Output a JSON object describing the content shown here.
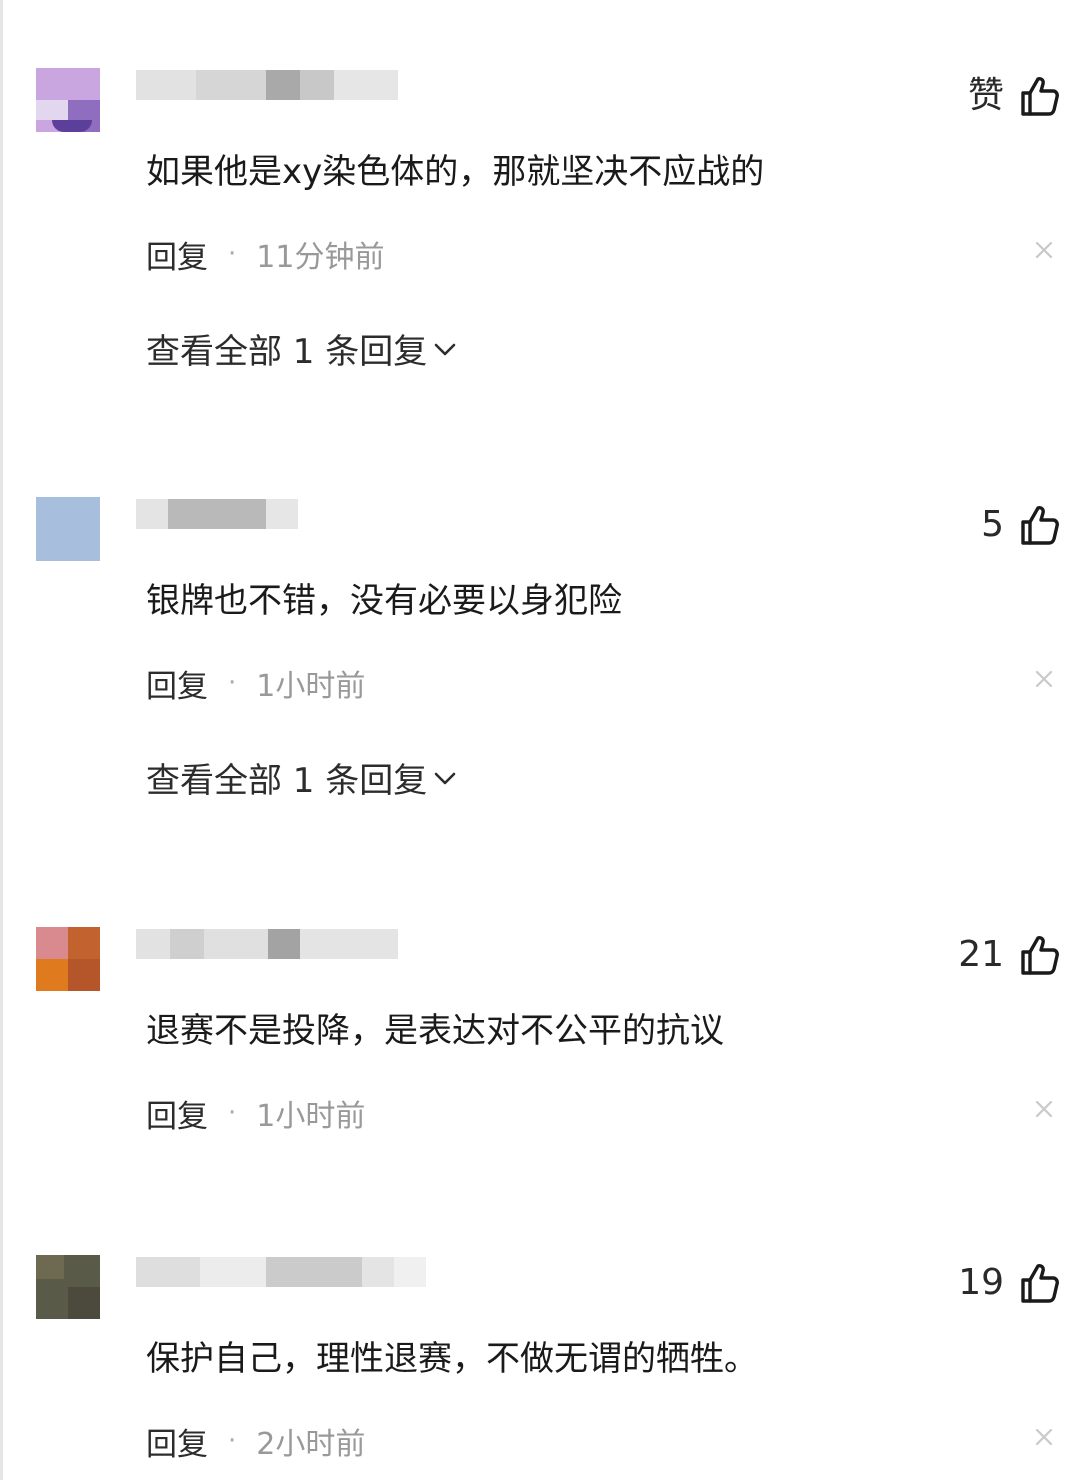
{
  "comments": [
    {
      "like_label": "赞",
      "text": "如果他是xy染色体的，那就坚决不应战的",
      "reply_label": "回复",
      "separator": "·",
      "time": "11分钟前",
      "view_replies": "查看全部 1 条回复",
      "avatar_colors": [
        "#c9a6e0",
        "#8f6dbf",
        "#e7def0",
        "#5b3f9a"
      ]
    },
    {
      "like_count": "5",
      "text": "银牌也不错，没有必要以身犯险",
      "reply_label": "回复",
      "separator": "·",
      "time": "1小时前",
      "view_replies": "查看全部 1 条回复",
      "avatar_colors": [
        "#a8bedd",
        "#b7c9e4",
        "#9fb5d6",
        "#c3d2e8"
      ]
    },
    {
      "like_count": "21",
      "text": "退赛不是投降，是表达对不公平的抗议",
      "reply_label": "回复",
      "separator": "·",
      "time": "1小时前",
      "avatar_colors": [
        "#d98a8e",
        "#c2632f",
        "#e07a1f",
        "#8a3b22"
      ]
    },
    {
      "like_count": "19",
      "text": "保护自己，理性退赛，不做无谓的牺牲。",
      "reply_label": "回复",
      "separator": "·",
      "time": "2小时前",
      "avatar_colors": [
        "#5a5a48",
        "#6e6a52",
        "#4c4a3c",
        "#7a7660"
      ]
    }
  ]
}
